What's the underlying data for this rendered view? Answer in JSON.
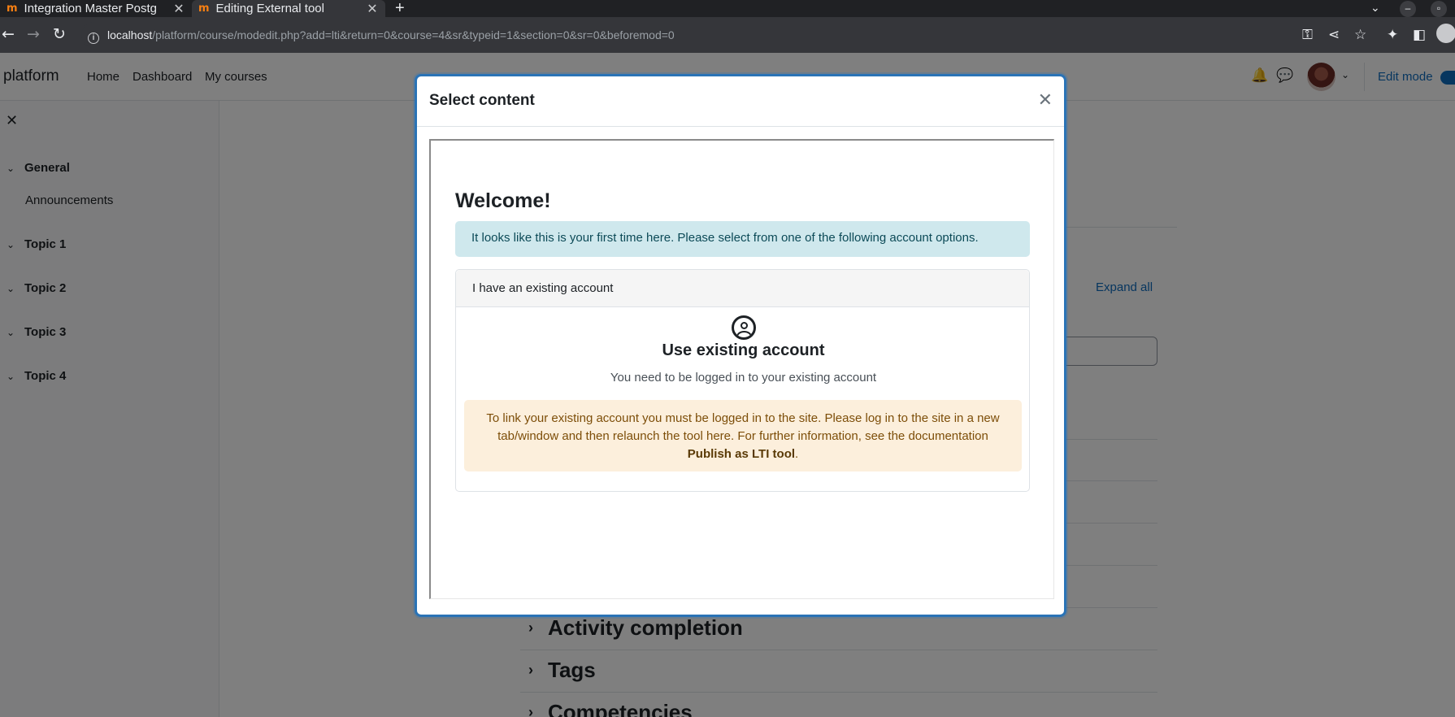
{
  "browser": {
    "tabs": [
      {
        "title": "Integration Master Postg",
        "favicon": "m"
      },
      {
        "title": "Editing External tool",
        "favicon": "m"
      }
    ],
    "url_host": "localhost",
    "url_path": "/platform/course/modedit.php?add=lti&return=0&course=4&sr&typeid=1&section=0&sr=0&beforemod=0"
  },
  "navbar": {
    "brand": "platform",
    "links": [
      "Home",
      "Dashboard",
      "My courses"
    ],
    "edit_mode_label": "Edit mode"
  },
  "drawer": {
    "sections": [
      {
        "label": "General",
        "activities": [
          "Announcements"
        ]
      },
      {
        "label": "Topic 1"
      },
      {
        "label": "Topic 2"
      },
      {
        "label": "Topic 3"
      },
      {
        "label": "Topic 4"
      }
    ]
  },
  "main": {
    "expand_all": "Expand all",
    "collapsibles": [
      "Activity completion",
      "Tags",
      "Competencies"
    ]
  },
  "modal": {
    "title": "Select content",
    "welcome": "Welcome!",
    "info_alert": "It looks like this is your first time here. Please select from one of the following account options.",
    "card_header": "I have an existing account",
    "card_title": "Use existing account",
    "card_subtitle": "You need to be logged in to your existing account",
    "warning_text": "To link your existing account you must be logged in to the site. Please log in to the site in a new tab/window and then relaunch the tool here. For further information, see the documentation",
    "warning_link": "Publish as LTI tool",
    "warning_end": "."
  },
  "colors": {
    "accent": "#0f6cbf",
    "modal_border": "#2a73b6",
    "info_bg": "#cfe8ed",
    "warning_bg": "#fcefdc"
  }
}
